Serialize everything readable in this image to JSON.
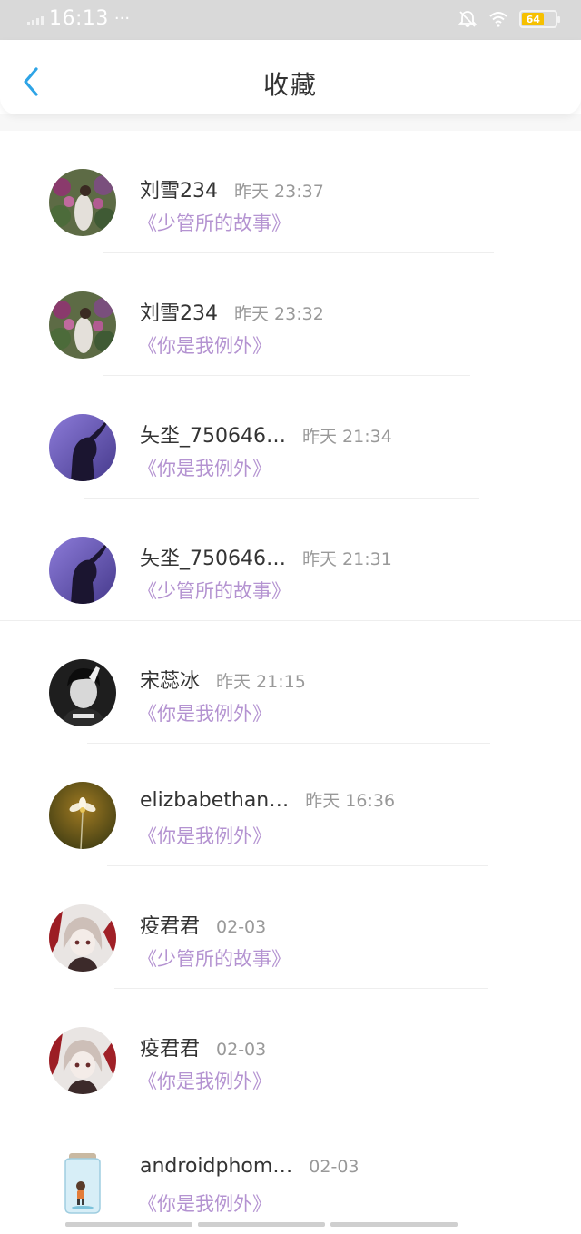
{
  "status_bar": {
    "time": "16:13",
    "dots": "···",
    "battery": "64",
    "battery_color": "#f6c000"
  },
  "header": {
    "title": "收藏"
  },
  "accent_color": "#2ea4e6",
  "book_color": "#b493d1",
  "items": [
    {
      "name": "刘雪234",
      "time": "昨天 23:37",
      "book": "《少管所的故事》",
      "avatar": "garden-photo"
    },
    {
      "name": "刘雪234",
      "time": "昨天 23:32",
      "book": "《你是我例外》",
      "avatar": "garden-photo"
    },
    {
      "name": "夨坔_750646…",
      "time": "昨天 21:34",
      "book": "《你是我例外》",
      "avatar": "purple-silhouette"
    },
    {
      "name": "夨坔_750646…",
      "time": "昨天 21:31",
      "book": "《少管所的故事》",
      "avatar": "purple-silhouette"
    },
    {
      "name": "宋蕊冰",
      "time": "昨天 21:15",
      "book": "《你是我例外》",
      "avatar": "bw-portrait"
    },
    {
      "name": "elizbabethan…",
      "time": "昨天 16:36",
      "book": "《你是我例外》",
      "avatar": "flower-photo"
    },
    {
      "name": "疫君君",
      "time": "02-03",
      "book": "《少管所的故事》",
      "avatar": "anime-girl"
    },
    {
      "name": "疫君君",
      "time": "02-03",
      "book": "《你是我例外》",
      "avatar": "anime-girl"
    },
    {
      "name": "androidphom…",
      "time": "02-03",
      "book": "《你是我例外》",
      "avatar": "jar-illustration"
    }
  ]
}
